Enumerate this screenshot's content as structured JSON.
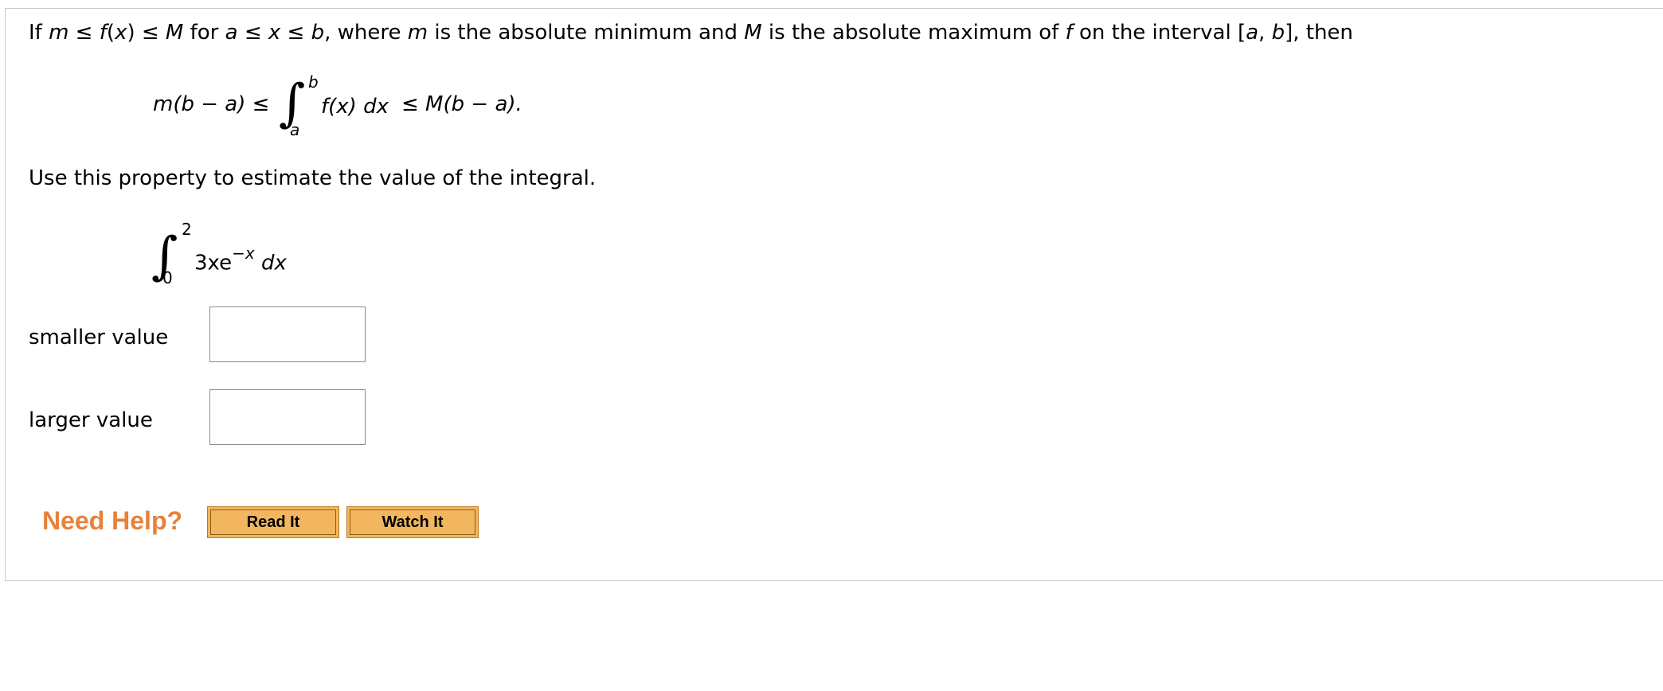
{
  "intro": {
    "p1": "If ",
    "m": "m",
    "p2": " ≤ ",
    "fx": "f",
    "p3": "(",
    "x1": "x",
    "p4": ") ≤ ",
    "M": "M",
    "p5": " for ",
    "a": "a",
    "p6": " ≤ ",
    "x2": "x",
    "p7": " ≤ ",
    "b": "b",
    "p8": ", where ",
    "m2": "m",
    "p9": " is the absolute minimum and ",
    "M2": "M",
    "p10": " is the absolute maximum of ",
    "f2": "f",
    "p11": " on the interval [",
    "a2": "a",
    "p12": ", ",
    "b2": "b",
    "p13": "], then"
  },
  "property": {
    "left": "m(b − a) ≤",
    "integral_sign": "∫",
    "upper": "b",
    "lower": "a",
    "integrand": "f(x) dx",
    "right": "≤ M(b − a)."
  },
  "instruction": "Use this property to estimate the value of the integral.",
  "problem": {
    "integral_sign": "∫",
    "upper": "2",
    "lower": "0",
    "coef": "3xe",
    "exponent": "−x",
    "dx": "dx"
  },
  "answers": {
    "smaller_label": "smaller value",
    "larger_label": "larger value",
    "smaller_value": "",
    "larger_value": ""
  },
  "help": {
    "title": "Need Help?",
    "read_it": "Read It",
    "watch_it": "Watch It"
  }
}
